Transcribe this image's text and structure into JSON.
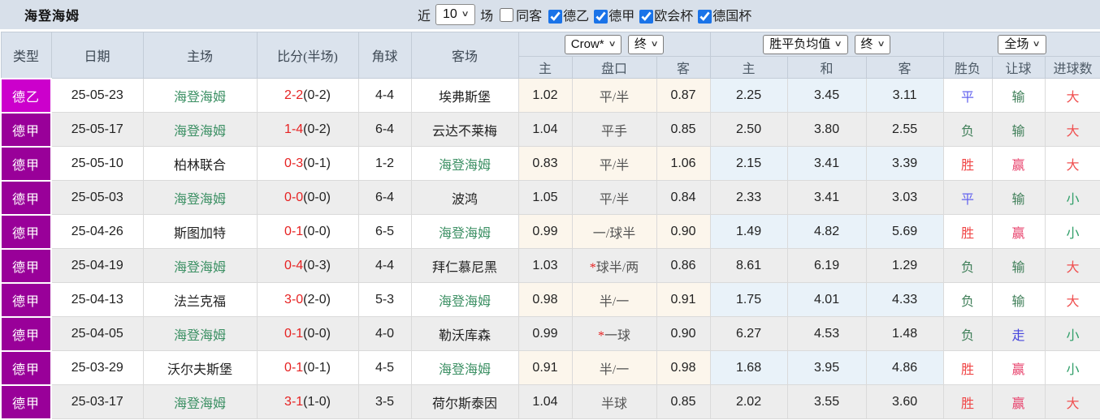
{
  "title": "海登海姆",
  "topbar": {
    "recent_label": "近",
    "recent_value": "10",
    "matches_label": "场",
    "same_opponent": {
      "label": "同客",
      "checked": false
    },
    "leagues": [
      {
        "label": "德乙",
        "checked": true
      },
      {
        "label": "德甲",
        "checked": true
      },
      {
        "label": "欧会杯",
        "checked": true
      },
      {
        "label": "德国杯",
        "checked": true
      }
    ]
  },
  "header": {
    "left_cols": [
      "类型",
      "日期",
      "主场",
      "比分(半场)",
      "角球",
      "客场"
    ],
    "crow_select": "Crow*",
    "crow_stage_select": "终",
    "crow_sub": [
      "主",
      "盘口",
      "客"
    ],
    "wdl_select": "胜平负均值",
    "wdl_stage_select": "终",
    "wdl_sub": [
      "主",
      "和",
      "客"
    ],
    "scope_select": "全场",
    "result_sub": [
      "胜负",
      "让球",
      "进球数"
    ]
  },
  "colors": {
    "league_d2": "#cc00cc",
    "league_d1": "#990099",
    "team_green": "#3c9064",
    "score_red": "#e62222",
    "win_red": "#f04545",
    "draw_blue": "#6262ee",
    "lose_green": "#41805a",
    "win_crimson": "#e8436d",
    "go_blue": "#4646dd",
    "big_red": "#f05050",
    "small_green": "#2f9e68",
    "accent_checkbox": "#1a73e8"
  },
  "rows": [
    {
      "league": "德乙",
      "league_color": "league_d2",
      "date": "25-05-23",
      "home": "海登海姆",
      "home_hl": true,
      "score": "2-2",
      "half": "(0-2)",
      "corners": "4-4",
      "away": "埃弗斯堡",
      "away_hl": false,
      "crow_home": "1.02",
      "handicap": "平/半",
      "handicap_star": false,
      "crow_away": "0.87",
      "avg_home": "2.25",
      "avg_draw": "3.45",
      "avg_away": "3.11",
      "result": {
        "t": "平",
        "c": "draw_blue"
      },
      "let": {
        "t": "输",
        "c": "lose_green"
      },
      "goals": {
        "t": "大",
        "c": "big_red"
      }
    },
    {
      "league": "德甲",
      "league_color": "league_d1",
      "date": "25-05-17",
      "home": "海登海姆",
      "home_hl": true,
      "score": "1-4",
      "half": "(0-2)",
      "corners": "6-4",
      "away": "云达不莱梅",
      "away_hl": false,
      "crow_home": "1.04",
      "handicap": "平手",
      "handicap_star": false,
      "crow_away": "0.85",
      "avg_home": "2.50",
      "avg_draw": "3.80",
      "avg_away": "2.55",
      "result": {
        "t": "负",
        "c": "lose_green"
      },
      "let": {
        "t": "输",
        "c": "lose_green"
      },
      "goals": {
        "t": "大",
        "c": "big_red"
      }
    },
    {
      "league": "德甲",
      "league_color": "league_d1",
      "date": "25-05-10",
      "home": "柏林联合",
      "home_hl": false,
      "score": "0-3",
      "half": "(0-1)",
      "corners": "1-2",
      "away": "海登海姆",
      "away_hl": true,
      "crow_home": "0.83",
      "handicap": "平/半",
      "handicap_star": false,
      "crow_away": "1.06",
      "avg_home": "2.15",
      "avg_draw": "3.41",
      "avg_away": "3.39",
      "result": {
        "t": "胜",
        "c": "win_red"
      },
      "let": {
        "t": "赢",
        "c": "win_crimson"
      },
      "goals": {
        "t": "大",
        "c": "big_red"
      }
    },
    {
      "league": "德甲",
      "league_color": "league_d1",
      "date": "25-05-03",
      "home": "海登海姆",
      "home_hl": true,
      "score": "0-0",
      "half": "(0-0)",
      "corners": "6-4",
      "away": "波鸿",
      "away_hl": false,
      "crow_home": "1.05",
      "handicap": "平/半",
      "handicap_star": false,
      "crow_away": "0.84",
      "avg_home": "2.33",
      "avg_draw": "3.41",
      "avg_away": "3.03",
      "result": {
        "t": "平",
        "c": "draw_blue"
      },
      "let": {
        "t": "输",
        "c": "lose_green"
      },
      "goals": {
        "t": "小",
        "c": "small_green"
      }
    },
    {
      "league": "德甲",
      "league_color": "league_d1",
      "date": "25-04-26",
      "home": "斯图加特",
      "home_hl": false,
      "score": "0-1",
      "half": "(0-0)",
      "corners": "6-5",
      "away": "海登海姆",
      "away_hl": true,
      "crow_home": "0.99",
      "handicap": "一/球半",
      "handicap_star": false,
      "crow_away": "0.90",
      "avg_home": "1.49",
      "avg_draw": "4.82",
      "avg_away": "5.69",
      "result": {
        "t": "胜",
        "c": "win_red"
      },
      "let": {
        "t": "赢",
        "c": "win_crimson"
      },
      "goals": {
        "t": "小",
        "c": "small_green"
      }
    },
    {
      "league": "德甲",
      "league_color": "league_d1",
      "date": "25-04-19",
      "home": "海登海姆",
      "home_hl": true,
      "score": "0-4",
      "half": "(0-3)",
      "corners": "4-4",
      "away": "拜仁慕尼黑",
      "away_hl": false,
      "crow_home": "1.03",
      "handicap": "球半/两",
      "handicap_star": true,
      "crow_away": "0.86",
      "avg_home": "8.61",
      "avg_draw": "6.19",
      "avg_away": "1.29",
      "result": {
        "t": "负",
        "c": "lose_green"
      },
      "let": {
        "t": "输",
        "c": "lose_green"
      },
      "goals": {
        "t": "大",
        "c": "big_red"
      }
    },
    {
      "league": "德甲",
      "league_color": "league_d1",
      "date": "25-04-13",
      "home": "法兰克福",
      "home_hl": false,
      "score": "3-0",
      "half": "(2-0)",
      "corners": "5-3",
      "away": "海登海姆",
      "away_hl": true,
      "crow_home": "0.98",
      "handicap": "半/一",
      "handicap_star": false,
      "crow_away": "0.91",
      "avg_home": "1.75",
      "avg_draw": "4.01",
      "avg_away": "4.33",
      "result": {
        "t": "负",
        "c": "lose_green"
      },
      "let": {
        "t": "输",
        "c": "lose_green"
      },
      "goals": {
        "t": "大",
        "c": "big_red"
      }
    },
    {
      "league": "德甲",
      "league_color": "league_d1",
      "date": "25-04-05",
      "home": "海登海姆",
      "home_hl": true,
      "score": "0-1",
      "half": "(0-0)",
      "corners": "4-0",
      "away": "勒沃库森",
      "away_hl": false,
      "crow_home": "0.99",
      "handicap": "一球",
      "handicap_star": true,
      "crow_away": "0.90",
      "avg_home": "6.27",
      "avg_draw": "4.53",
      "avg_away": "1.48",
      "result": {
        "t": "负",
        "c": "lose_green"
      },
      "let": {
        "t": "走",
        "c": "go_blue"
      },
      "goals": {
        "t": "小",
        "c": "small_green"
      }
    },
    {
      "league": "德甲",
      "league_color": "league_d1",
      "date": "25-03-29",
      "home": "沃尔夫斯堡",
      "home_hl": false,
      "score": "0-1",
      "half": "(0-1)",
      "corners": "4-5",
      "away": "海登海姆",
      "away_hl": true,
      "crow_home": "0.91",
      "handicap": "半/一",
      "handicap_star": false,
      "crow_away": "0.98",
      "avg_home": "1.68",
      "avg_draw": "3.95",
      "avg_away": "4.86",
      "result": {
        "t": "胜",
        "c": "win_red"
      },
      "let": {
        "t": "赢",
        "c": "win_crimson"
      },
      "goals": {
        "t": "小",
        "c": "small_green"
      }
    },
    {
      "league": "德甲",
      "league_color": "league_d1",
      "date": "25-03-17",
      "home": "海登海姆",
      "home_hl": true,
      "score": "3-1",
      "half": "(1-0)",
      "corners": "3-5",
      "away": "荷尔斯泰因",
      "away_hl": false,
      "crow_home": "1.04",
      "handicap": "半球",
      "handicap_star": false,
      "crow_away": "0.85",
      "avg_home": "2.02",
      "avg_draw": "3.55",
      "avg_away": "3.60",
      "result": {
        "t": "胜",
        "c": "win_red"
      },
      "let": {
        "t": "赢",
        "c": "win_crimson"
      },
      "goals": {
        "t": "大",
        "c": "big_red"
      }
    }
  ]
}
